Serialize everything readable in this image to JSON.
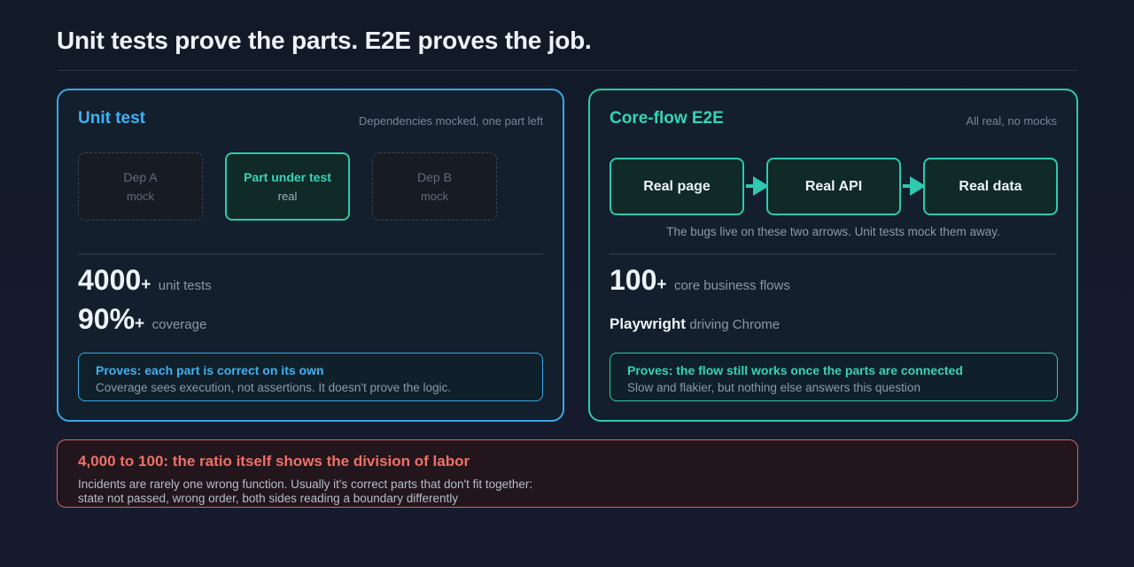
{
  "title": "Unit tests prove the parts. E2E proves the job.",
  "unit": {
    "title": "Unit test",
    "subtitle": "Dependencies mocked, one part left",
    "boxes": [
      {
        "name": "Dep A",
        "kind": "mock"
      },
      {
        "name": "Part under test",
        "kind": "real"
      },
      {
        "name": "Dep B",
        "kind": "mock"
      }
    ],
    "stats": [
      {
        "value": "4000",
        "suffix": "+",
        "label": "unit tests"
      },
      {
        "value": "90%",
        "suffix": "+",
        "label": "coverage"
      }
    ],
    "proves": {
      "heading": "Proves: each part is correct on its own",
      "body": "Coverage sees execution, not assertions. It doesn't prove the logic."
    }
  },
  "e2e": {
    "title": "Core-flow E2E",
    "subtitle": "All real, no mocks",
    "flow": [
      "Real page",
      "Real API",
      "Real data"
    ],
    "flow_note": "The bugs live on these two arrows. Unit tests mock them away.",
    "stat": {
      "value": "100",
      "suffix": "+",
      "label": "core business flows"
    },
    "tool": {
      "name": "Playwright",
      "label": "driving Chrome"
    },
    "proves": {
      "heading": "Proves: the flow still works once the parts are connected",
      "body": "Slow and flakier, but nothing else answers this question"
    }
  },
  "callout": {
    "heading": "4,000 to 100: the ratio itself shows the division of labor",
    "line1": "Incidents are rarely one wrong function. Usually it's correct parts that don't fit together:",
    "line2": "state not passed, wrong order, both sides reading a boundary differently"
  },
  "colors": {
    "unit_accent": "#38a7e6",
    "e2e_accent": "#2ec9ae",
    "warning": "#e2625a"
  }
}
